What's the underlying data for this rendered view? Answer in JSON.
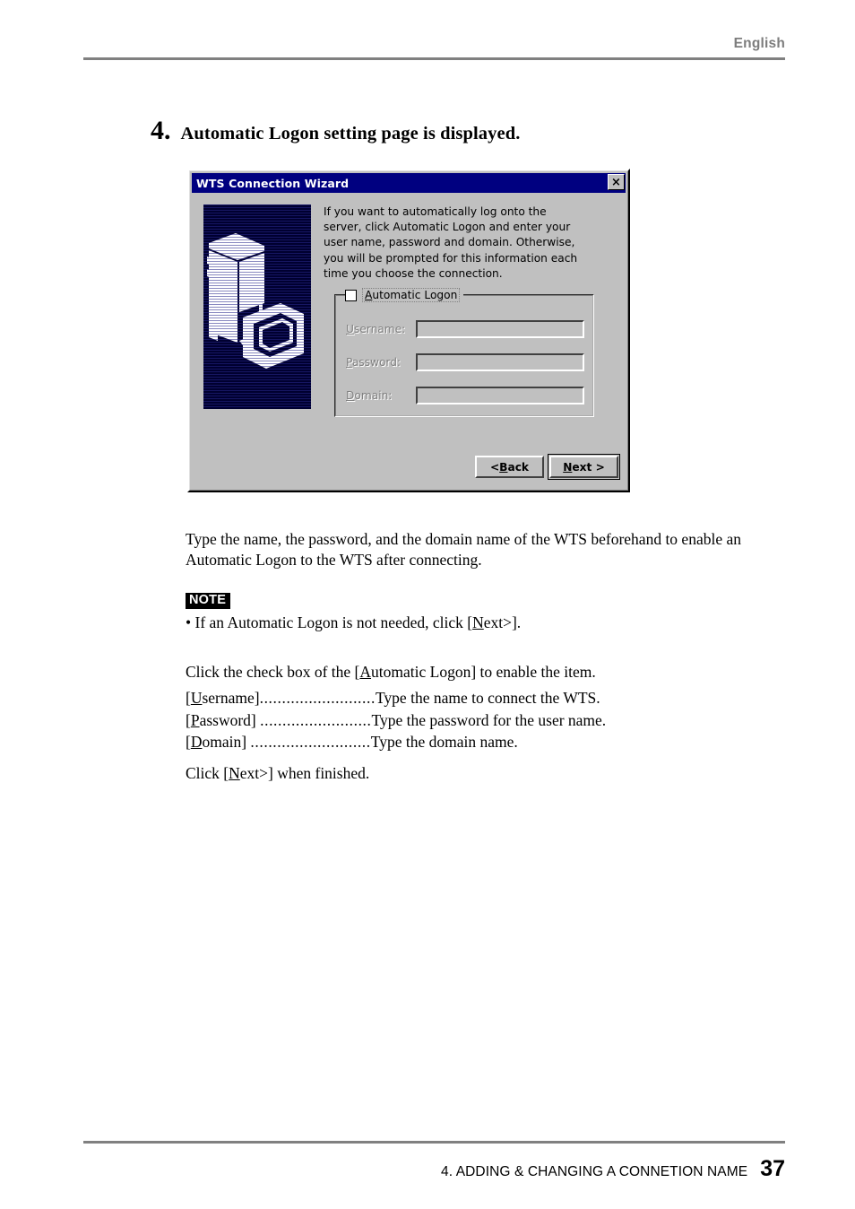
{
  "header": {
    "language_label": "English"
  },
  "step": {
    "number": "4.",
    "title": "Automatic Logon setting page is displayed."
  },
  "dialog": {
    "title": "WTS Connection Wizard",
    "close_label": "×",
    "description": "If you want to automatically log onto the\nserver, click Automatic Logon and enter your\nuser name, password and domain. Otherwise,\nyou will be prompted for this information each\ntime you choose the connection.",
    "groupbox": {
      "checkbox_label_pre": "",
      "checkbox_accel": "A",
      "checkbox_label_post": "utomatic Logon",
      "checkbox_checked": false
    },
    "fields": [
      {
        "accel": "U",
        "label_rest": "sername:",
        "value": "",
        "enabled": false
      },
      {
        "accel": "P",
        "label_rest": "assword:",
        "value": "",
        "enabled": false
      },
      {
        "accel": "D",
        "label_rest": "omain:",
        "value": "",
        "enabled": false
      }
    ],
    "buttons": [
      {
        "pre": "< ",
        "accel": "B",
        "post": "ack",
        "default": false
      },
      {
        "pre": "",
        "accel": "N",
        "post": "ext >",
        "default": true
      }
    ],
    "colors": {
      "titlebar": "#000080",
      "face": "#c0c0c0",
      "graphic_background": "#000030"
    }
  },
  "content": {
    "intro_paragraph": "Type the name, the password, and the domain name of the WTS beforehand to enable an Automatic Logon to the WTS after connecting.",
    "note_badge": "NOTE",
    "note_item_pre": "•  If an Automatic Logon is not needed, click [",
    "note_item_accel": "N",
    "note_item_post": "ext>].",
    "checkbox_paragraph_pre": "Click the check box of the [",
    "checkbox_paragraph_accel": "A",
    "checkbox_paragraph_post": "utomatic Logon] to enable the item.",
    "definitions": [
      {
        "term_open": "[",
        "accel": "U",
        "term_rest": "sername]",
        "leader": "..........................",
        "description": "Type the name to connect the WTS."
      },
      {
        "term_open": "[",
        "accel": "P",
        "term_rest": "assword] ",
        "leader": ".........................",
        "description": "Type the password for the user name."
      },
      {
        "term_open": "[",
        "accel": "D",
        "term_rest": "omain] ",
        "leader": "...........................",
        "description": "Type the domain name."
      }
    ],
    "finish_paragraph_pre": "Click [",
    "finish_paragraph_accel": "N",
    "finish_paragraph_post": "ext>] when finished."
  },
  "footer": {
    "chapter": "4. ADDING & CHANGING A CONNETION NAME",
    "page_number": "37"
  }
}
